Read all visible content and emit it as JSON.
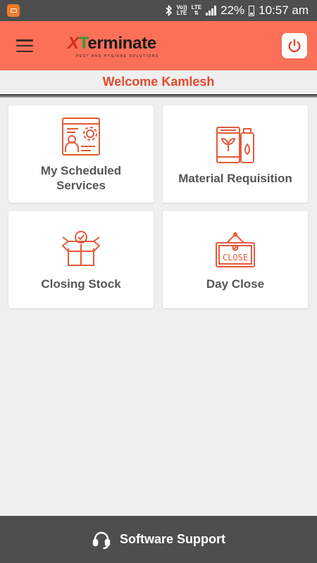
{
  "status_bar": {
    "volte": "Vo))",
    "lte_top": "LTE",
    "lte_bottom": "LTE",
    "lte2": "LTE",
    "battery": "22%",
    "time": "10:57 am"
  },
  "header": {
    "logo_x": "X",
    "logo_t": "T",
    "logo_rest": "erminate",
    "logo_sub": "PEST AND HYGIENE SOLUTIONS"
  },
  "welcome": "Welcome Kamlesh",
  "tiles": [
    {
      "label": "My Scheduled Services",
      "icon": "scheduled-services-icon"
    },
    {
      "label": "Material Requisition",
      "icon": "material-requisition-icon"
    },
    {
      "label": "Closing Stock",
      "icon": "closing-stock-icon"
    },
    {
      "label": "Day Close",
      "icon": "day-close-icon"
    }
  ],
  "footer": {
    "label": "Software Support",
    "icon": "headset-icon"
  },
  "colors": {
    "accent": "#fc7058",
    "icon": "#e25b3c",
    "dark": "#4e4e4e",
    "welcome": "#e44a2e"
  },
  "day_close_sign": "CLOSE"
}
